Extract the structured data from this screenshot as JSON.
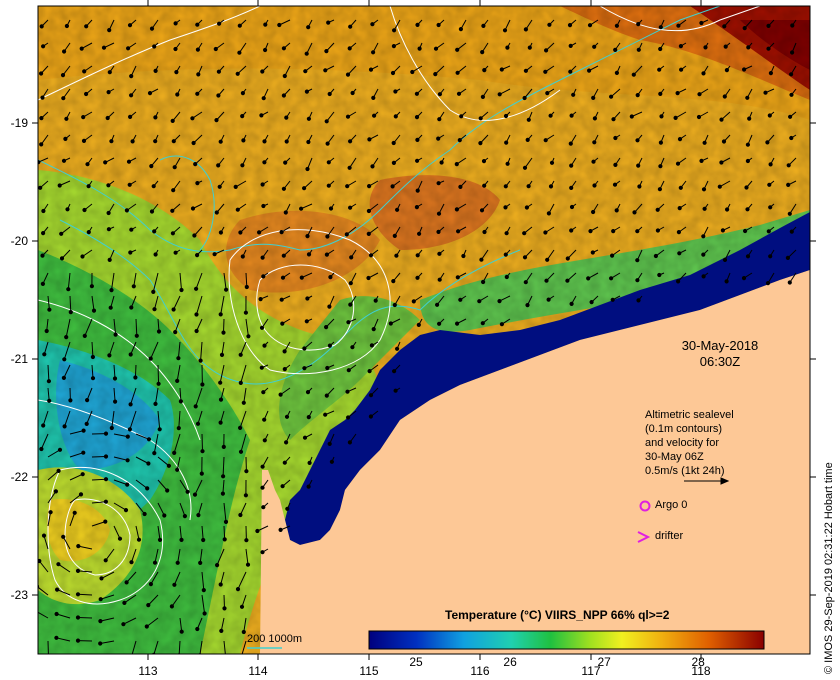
{
  "map": {
    "x_axis_ticks": [
      "113",
      "114",
      "115",
      "116",
      "117",
      "118"
    ],
    "y_axis_ticks": [
      "-19",
      "-20",
      "-21",
      "-22",
      "-23"
    ]
  },
  "date": {
    "line1": "30-May-2018",
    "line2": "06:30Z"
  },
  "legend": {
    "line1": "Altimetric sealevel",
    "line2": "(0.1m contours)",
    "line3": "and velocity for",
    "line4": "30-May 06Z",
    "line5": "0.5m/s (1kt 24h)",
    "argo_label": "Argo 0",
    "drifter_label": "drifter"
  },
  "colorbar": {
    "title": "Temperature (°C) VIIRS_NPP 66% ql>=2",
    "ticks": [
      "25",
      "26",
      "27",
      "28"
    ],
    "ticks_values": [
      25,
      26,
      27,
      28
    ],
    "range": [
      24.5,
      28.7
    ]
  },
  "isobath": {
    "label": "200  1000m"
  },
  "credit": "© IMOS 29-Sep-2019 02:31:22 Hobart time",
  "colors": {
    "land": "#fdc896",
    "shelf": "#000e7f",
    "isobath": "#40d0d0",
    "contour": "#ffffff",
    "argo": "#e020e0"
  }
}
